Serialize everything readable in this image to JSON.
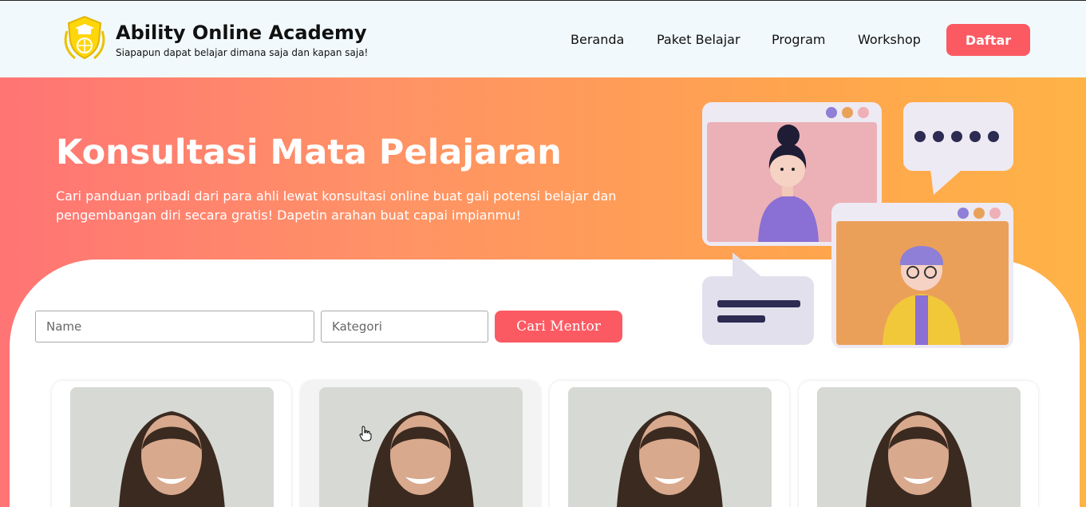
{
  "brand": {
    "title": "Ability Online Academy",
    "tagline": "Siapapun dapat belajar dimana saja dan kapan saja!"
  },
  "nav": {
    "items": [
      {
        "label": "Beranda"
      },
      {
        "label": "Paket Belajar"
      },
      {
        "label": "Program"
      },
      {
        "label": "Workshop"
      }
    ],
    "register_label": "Daftar"
  },
  "hero": {
    "title": "Konsultasi Mata Pelajaran",
    "description": "Cari panduan pribadi dari para ahli lewat konsultasi online buat gali potensi belajar dan pengembangan diri secara gratis! Dapetin arahan buat capai impianmu!"
  },
  "search": {
    "name_placeholder": "Name",
    "category_placeholder": "Kategori",
    "button_label": "Cari Mentor"
  },
  "colors": {
    "accent": "#fb5a63",
    "header_bg": "#f1f9fc",
    "gradient_start": "#ff7474",
    "gradient_end": "#ffb347"
  },
  "mentors": [
    {
      "photo": "mentor-photo"
    },
    {
      "photo": "mentor-photo"
    },
    {
      "photo": "mentor-photo"
    },
    {
      "photo": "mentor-photo"
    }
  ]
}
